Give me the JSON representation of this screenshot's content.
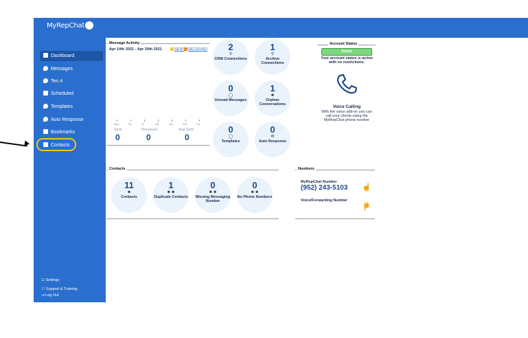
{
  "app": {
    "logo_text": "MyRepChat"
  },
  "sidebar": {
    "items": [
      {
        "label": "Dashboard",
        "icon": "dashboard-icon"
      },
      {
        "label": "Messages",
        "icon": "chat-bubble-icon"
      },
      {
        "label": "Ten 4",
        "icon": "chat-bubble-icon"
      },
      {
        "label": "Scheduled",
        "icon": "calendar-icon"
      },
      {
        "label": "Templates",
        "icon": "template-icon"
      },
      {
        "label": "Auto Response",
        "icon": "robot-icon"
      },
      {
        "label": "Bookmarks",
        "icon": "bookmark-icon"
      },
      {
        "label": "Contacts",
        "icon": "contact-card-icon"
      }
    ],
    "footer": {
      "settings": "Settings",
      "support": "Support & Training",
      "logout": "Log Out"
    }
  },
  "activity": {
    "title": "Message Activity",
    "date_range": "Apr 14th 2021 - Apr 20th 2021",
    "legend_sent": "SENT",
    "legend_received": "RECEIVED",
    "days": [
      "Wed",
      "Thu",
      "Fri",
      "Sat",
      "Sun",
      "Mon",
      "Tue"
    ],
    "sent_label": "Sent",
    "sent_value": "0",
    "received_label": "Received",
    "received_value": "0",
    "avg_label": "Avg Sent",
    "avg_value": "0",
    "colors": {
      "sent": "#f4c842",
      "received": "#f08c1c"
    }
  },
  "tiles": {
    "crm": {
      "value": "2",
      "label": "CRM Connections"
    },
    "archive": {
      "value": "1",
      "label": "Archive Connections"
    },
    "unread": {
      "value": "0",
      "label": "Unread Messages"
    },
    "orphan": {
      "value": "1",
      "label": "Orphan Conversations"
    },
    "templates": {
      "value": "0",
      "label": "Templates"
    },
    "auto": {
      "value": "0",
      "label": "Auto Response"
    }
  },
  "account": {
    "title": "Account Status",
    "badge": "Active",
    "message": "Your account status is active with no restrictions.",
    "voice_title": "Voice Calling",
    "voice_text": "With the voice add-on you can call your clients using the MyRepChat phone number"
  },
  "contacts": {
    "title": "Contacts",
    "tiles": [
      {
        "value": "11",
        "label": "Contacts"
      },
      {
        "value": "1",
        "label": "Duplicate Contacts"
      },
      {
        "value": "0",
        "label": "Missing Messaging Number"
      },
      {
        "value": "0",
        "label": "No Phone Numbers"
      }
    ]
  },
  "numbers": {
    "title": "Numbers",
    "myrepchat_label": "MyRepChat Number",
    "myrepchat_value": "(952) 243-5103",
    "forwarding_label": "Voice/Forwarding Number"
  },
  "colors": {
    "brand": "#2a6fce",
    "active_badge": "#7ed67e",
    "thumb_up": "#2eaa2e",
    "thumb_down": "#e02020",
    "highlight_ring": "#f3c31c"
  }
}
